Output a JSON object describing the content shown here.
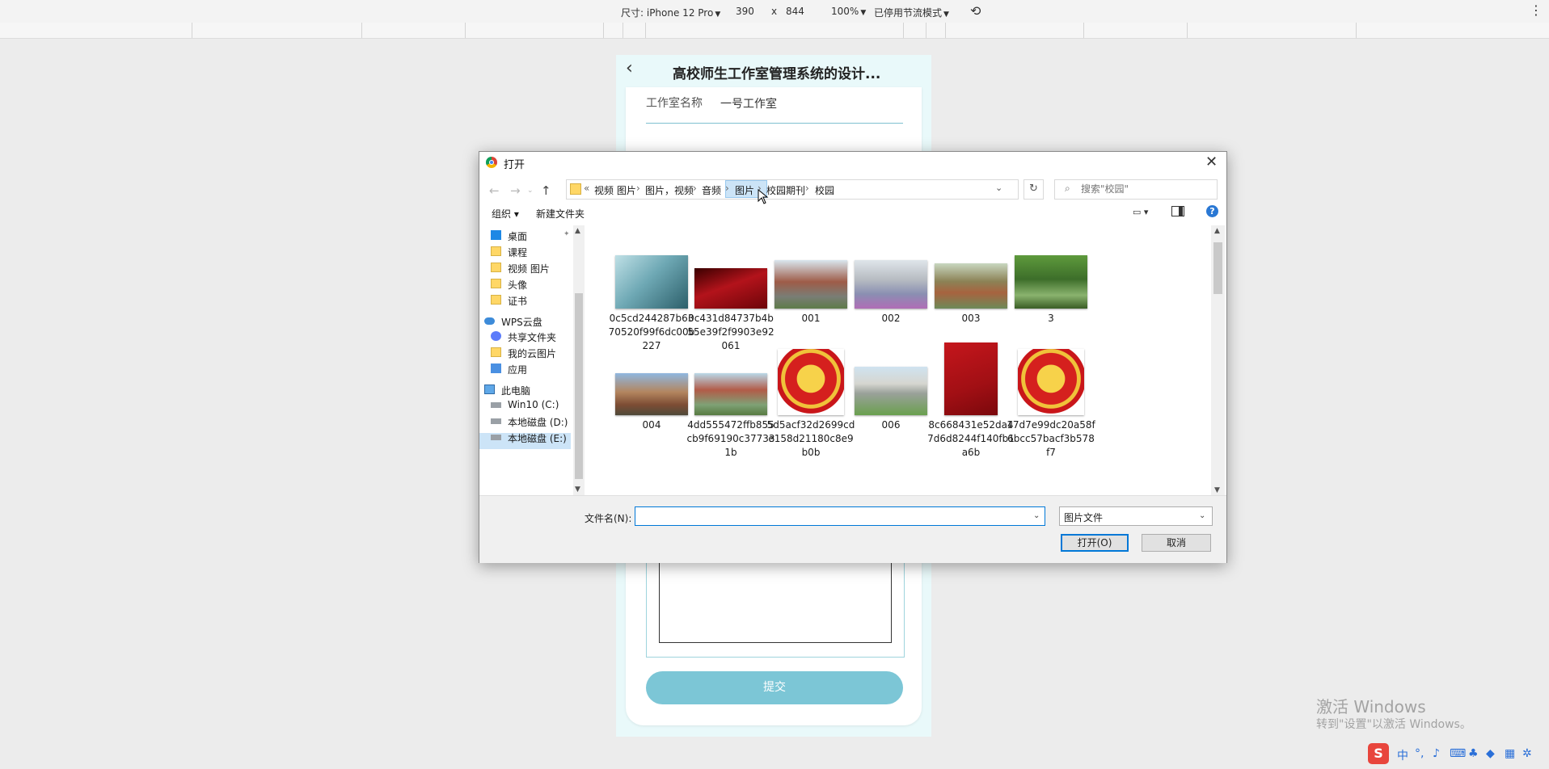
{
  "devtools": {
    "device_label": "尺寸: iPhone 12 Pro",
    "width": "390",
    "times": "x",
    "height": "844",
    "zoom": "100%",
    "throttle": "已停用节流模式"
  },
  "phone_page": {
    "title": "高校师生工作室管理系统的设计...",
    "field_label": "工作室名称",
    "field_value": "一号工作室",
    "submit_label": "提交"
  },
  "dialog": {
    "title": "打开",
    "breadcrumb": [
      "视频 图片",
      "图片，视频",
      "音频",
      "图片",
      "校园期刊",
      "校园"
    ],
    "breadcrumb_prefix": "«",
    "search_placeholder": "搜索\"校园\"",
    "toolbar": {
      "organize": "组织 ▾",
      "new_folder": "新建文件夹",
      "help": "?"
    },
    "nav_items": [
      {
        "label": "桌面",
        "icon": "desktop-icon"
      },
      {
        "label": "课程",
        "icon": "folder-icon"
      },
      {
        "label": "视频 图片",
        "icon": "folder-icon"
      },
      {
        "label": "头像",
        "icon": "folder-icon"
      },
      {
        "label": "证书",
        "icon": "folder-icon"
      },
      {
        "label": "WPS云盘",
        "icon": "cloud-icon"
      },
      {
        "label": "共享文件夹",
        "icon": "share-icon"
      },
      {
        "label": "我的云图片",
        "icon": "folder-icon"
      },
      {
        "label": "应用",
        "icon": "apps-icon"
      },
      {
        "label": "此电脑",
        "icon": "computer-icon"
      },
      {
        "label": "Win10 (C:)",
        "icon": "drive-icon"
      },
      {
        "label": "本地磁盘 (D:)",
        "icon": "drive-icon"
      },
      {
        "label": "本地磁盘 (E:)",
        "icon": "drive-icon"
      }
    ],
    "files": [
      {
        "name": "0c5cd244287b6370520f99f6dc00b227",
        "thumb": "card"
      },
      {
        "name": "0c431d84737b4b55e39f2f9903e92061",
        "thumb": "redbook"
      },
      {
        "name": "001",
        "thumb": "campus1"
      },
      {
        "name": "002",
        "thumb": "campus2"
      },
      {
        "name": "003",
        "thumb": "campus3"
      },
      {
        "name": "3",
        "thumb": "trees"
      },
      {
        "name": "004",
        "thumb": "building"
      },
      {
        "name": "4dd555472ffb855cb9f69190c377331b",
        "thumb": "campus4"
      },
      {
        "name": "5d5acf32d2699cde158d21180c8e9b0b",
        "thumb": "badge"
      },
      {
        "name": "006",
        "thumb": "campus5"
      },
      {
        "name": "8c668431e52da47d6d8244f140fb1a6b",
        "thumb": "redbook2"
      },
      {
        "name": "17d7e99dc20a58f6bcc57bacf3b578f7",
        "thumb": "badge"
      }
    ],
    "filename_label": "文件名(N):",
    "filename_value": "",
    "filetype": "图片文件",
    "open_label": "打开(O)",
    "cancel_label": "取消"
  },
  "watermark": {
    "line1": "激活 Windows",
    "line2": "转到\"设置\"以激活 Windows。"
  },
  "ime": {
    "lang": "中"
  }
}
